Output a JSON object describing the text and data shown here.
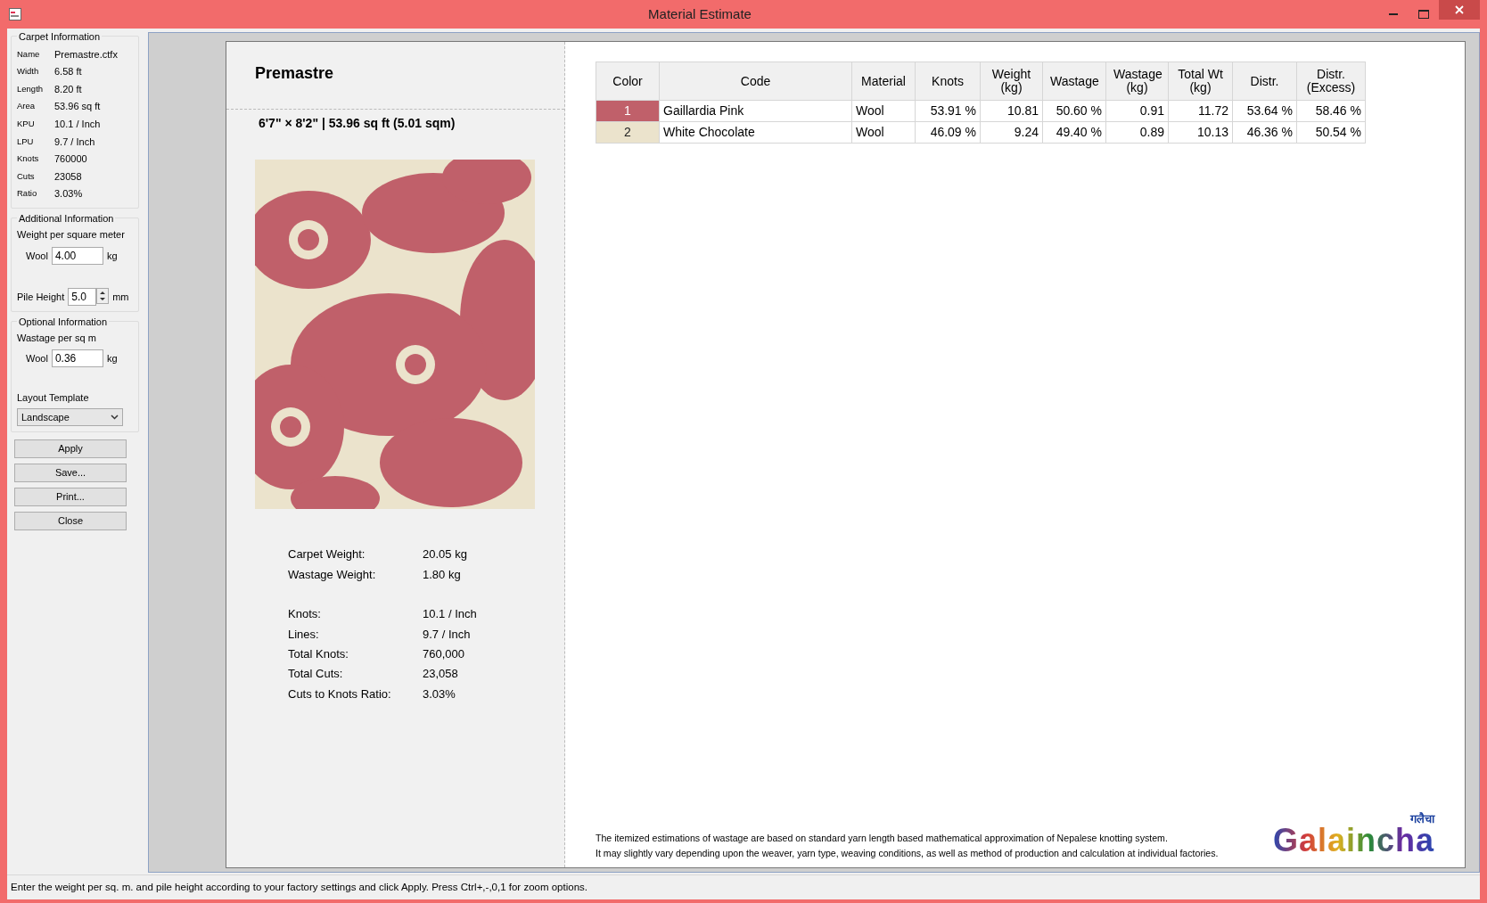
{
  "window": {
    "title": "Material Estimate"
  },
  "carpet_information": {
    "title": "Carpet Information",
    "fields": [
      {
        "label": "Name",
        "value": "Premastre.ctfx"
      },
      {
        "label": "Width",
        "value": "6.58 ft"
      },
      {
        "label": "Length",
        "value": "8.20 ft"
      },
      {
        "label": "Area",
        "value": "53.96 sq ft"
      },
      {
        "label": "KPU",
        "value": "10.1 / Inch"
      },
      {
        "label": "LPU",
        "value": "9.7 / Inch"
      },
      {
        "label": "Knots",
        "value": "760000"
      },
      {
        "label": "Cuts",
        "value": "23058"
      },
      {
        "label": "Ratio",
        "value": "3.03%"
      }
    ]
  },
  "additional_information": {
    "title": "Additional Information",
    "subtitle": "Weight per square meter",
    "field_label": "Wool",
    "field_value": "4.00",
    "unit": "kg",
    "pile_height_label": "Pile Height",
    "pile_height_value": "5.0",
    "pile_height_unit": "mm"
  },
  "optional_information": {
    "title": "Optional Information",
    "subtitle": "Wastage per sq m",
    "field_label": "Wool",
    "field_value": "0.36",
    "unit": "kg",
    "layout_template_label": "Layout Template",
    "layout_template_value": "Landscape"
  },
  "buttons": [
    "Apply",
    "Save...",
    "Print...",
    "Close"
  ],
  "report": {
    "title": "Premastre",
    "dimensions": "6'7\" × 8'2\" | 53.96 sq ft (5.01 sqm)",
    "summary_groups": [
      [
        {
          "label": "Carpet Weight:",
          "value": "20.05 kg"
        },
        {
          "label": "Wastage Weight:",
          "value": "1.80 kg"
        }
      ],
      [
        {
          "label": "Knots:",
          "value": "10.1 / Inch"
        },
        {
          "label": "Lines:",
          "value": "9.7 / Inch"
        },
        {
          "label": "Total Knots:",
          "value": "760,000"
        },
        {
          "label": "Total Cuts:",
          "value": "23,058"
        },
        {
          "label": "Cuts to Knots Ratio:",
          "value": "3.03%"
        }
      ]
    ],
    "table": {
      "columns": [
        "Color",
        "Code",
        "Material",
        "Knots",
        "Weight (kg)",
        "Wastage",
        "Wastage (kg)",
        "Total Wt (kg)",
        "Distr.",
        "Distr. (Excess)"
      ],
      "rows": [
        {
          "color": "#c0606a",
          "cells": [
            "1",
            "Gaillardia Pink",
            "Wool",
            "53.91 %",
            "10.81",
            "50.60 %",
            "0.91",
            "11.72",
            "53.64 %",
            "58.46 %"
          ]
        },
        {
          "color": "#ebe3cc",
          "cells": [
            "2",
            "White Chocolate",
            "Wool",
            "46.09 %",
            "9.24",
            "49.40 %",
            "0.89",
            "10.13",
            "46.36 %",
            "50.54 %"
          ]
        }
      ]
    },
    "footnote": [
      "The itemized estimations of wastage are based on standard yarn length based mathematical approximation of Nepalese knotting system.",
      "It may slightly vary depending upon the weaver, yarn type, weaving conditions, as well as method of production and calculation at individual factories."
    ],
    "logo": {
      "text": "Galaincha",
      "script_text": "गलैचा"
    }
  },
  "status_bar": "Enter the weight per sq. m. and pile height according to your factory settings and click Apply. Press Ctrl+,-,0,1 for zoom options."
}
